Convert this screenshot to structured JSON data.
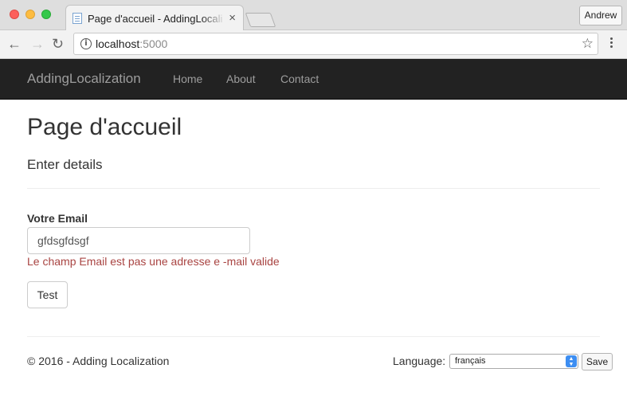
{
  "browser": {
    "tab_title": "Page d'accueil - AddingLocalization",
    "tab_close": "×",
    "user_button": "Andrew",
    "url_host": "localhost",
    "url_port": ":5000",
    "icons": [
      "back-arrow-icon",
      "forward-arrow-icon",
      "reload-icon",
      "info-icon",
      "star-icon",
      "menu-icon"
    ]
  },
  "navbar": {
    "brand": "AddingLocalization",
    "links": [
      {
        "label": "Home"
      },
      {
        "label": "About"
      },
      {
        "label": "Contact"
      }
    ]
  },
  "main": {
    "title": "Page d'accueil",
    "subtitle": "Enter details",
    "email_label": "Votre Email",
    "email_value": "gfdsgfdsgf",
    "validation_message": "Le champ Email est pas une adresse e -mail valide",
    "test_button": "Test"
  },
  "footer": {
    "copyright": "© 2016 - Adding Localization",
    "language_label": "Language:",
    "language_selected": "français",
    "save_button": "Save"
  },
  "colors": {
    "navbar_bg": "#222222",
    "navbar_text": "#9d9d9d",
    "validation_error": "#a94442"
  }
}
